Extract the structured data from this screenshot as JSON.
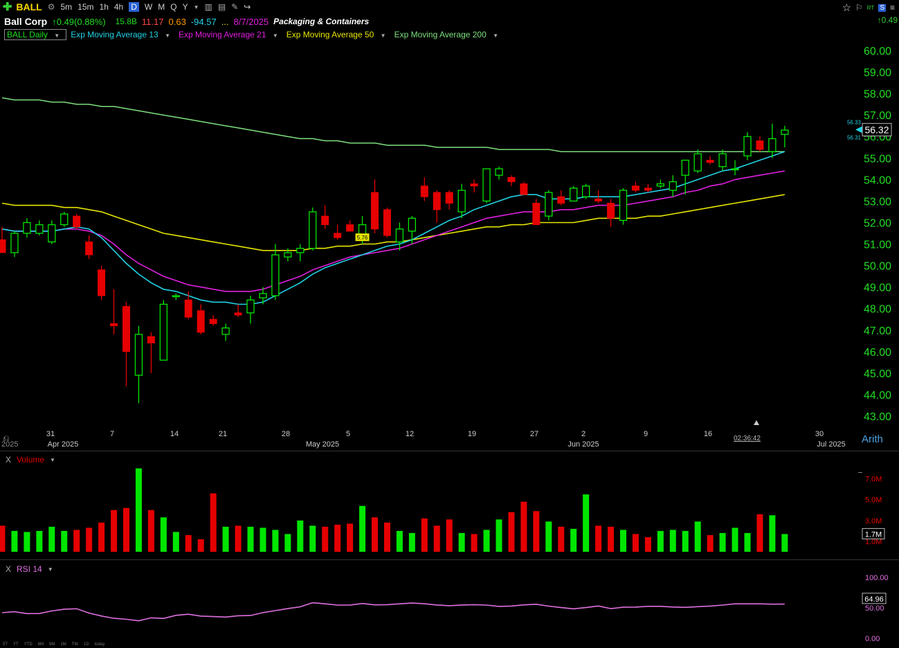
{
  "toolbar": {
    "symbol": "BALL",
    "timeframes": [
      "5m",
      "15m",
      "1h",
      "4h",
      "D",
      "W",
      "M",
      "Q",
      "Y"
    ],
    "active_timeframe": "D"
  },
  "quote": {
    "name": "Ball Corp",
    "change": "0.49(0.88%)",
    "market_cap": "15.8B",
    "stat1": "11.17",
    "stat2": "0.63",
    "stat3": "-94.57",
    "ellipsis": "...",
    "earnings_date": "8/7/2025",
    "industry": "Packaging & Containers"
  },
  "top_right": {
    "rt": "RT",
    "change": "0.49"
  },
  "studies": {
    "main": "BALL Daily",
    "ema13": "Exp Moving Average 13",
    "ema21": "Exp Moving Average 21",
    "ema50": "Exp Moving Average 50",
    "ema200": "Exp Moving Average 200"
  },
  "colors": {
    "up": "#00e600",
    "down": "#e60000",
    "ema13": "#22d3e6",
    "ema21": "#e020e0",
    "ema50": "#e6e600",
    "ema200": "#7de07d",
    "rsi": "#e070e0",
    "axis_text": "#22dd22"
  },
  "price_axis": {
    "labels": [
      "60.00",
      "59.00",
      "58.00",
      "57.00",
      "56.00",
      "55.00",
      "54.00",
      "53.00",
      "52.00",
      "51.00",
      "50.00",
      "49.00",
      "48.00",
      "47.00",
      "46.00",
      "45.00",
      "44.00",
      "43.00"
    ],
    "last_price": "56.32",
    "bid": "56.33",
    "ask": "56.31",
    "min": 43.0,
    "max": 60.0,
    "scale_label": "Arith",
    "timer": "02:36:42",
    "marker_label": "5.76"
  },
  "date_axis": {
    "labels": [
      "31",
      "Apr 2025",
      "7",
      "14",
      "21",
      "28",
      "May 2025",
      "5",
      "12",
      "19",
      "27",
      "Jun 2025",
      "2",
      "9",
      "16",
      "30",
      "Jul 2025"
    ],
    "cut_label": "2025"
  },
  "chart_data": {
    "type": "candlestick",
    "ohlc": [
      [
        51.2,
        51.8,
        50.8,
        50.6
      ],
      [
        50.6,
        51.6,
        50.4,
        51.5
      ],
      [
        51.5,
        52.2,
        51.3,
        52.0
      ],
      [
        51.5,
        52.1,
        51.4,
        51.9
      ],
      [
        51.1,
        52.1,
        51.0,
        51.9
      ],
      [
        51.9,
        52.5,
        51.8,
        52.4
      ],
      [
        52.3,
        52.4,
        51.7,
        51.8
      ],
      [
        51.1,
        51.4,
        50.3,
        50.5
      ],
      [
        49.8,
        50.0,
        48.4,
        48.6
      ],
      [
        47.3,
        48.9,
        46.8,
        47.2
      ],
      [
        48.1,
        48.3,
        44.4,
        46.0
      ],
      [
        44.9,
        47.2,
        43.6,
        46.8
      ],
      [
        46.7,
        46.9,
        45.0,
        46.4
      ],
      [
        45.6,
        48.4,
        45.7,
        48.2
      ],
      [
        48.6,
        48.7,
        48.4,
        48.6
      ],
      [
        48.4,
        48.8,
        47.5,
        47.6
      ],
      [
        47.9,
        48.2,
        46.8,
        46.9
      ],
      [
        47.5,
        47.7,
        47.2,
        47.3
      ],
      [
        46.8,
        47.3,
        46.5,
        47.1
      ],
      [
        47.8,
        48.2,
        47.6,
        47.7
      ],
      [
        47.8,
        48.6,
        47.3,
        48.4
      ],
      [
        48.5,
        49.0,
        48.2,
        48.7
      ],
      [
        48.6,
        51.0,
        48.4,
        50.5
      ],
      [
        50.4,
        50.8,
        50.2,
        50.6
      ],
      [
        50.6,
        51.0,
        50.2,
        50.8
      ],
      [
        50.8,
        52.7,
        50.7,
        52.5
      ],
      [
        52.3,
        52.8,
        51.7,
        51.9
      ],
      [
        51.5,
        51.9,
        51.2,
        51.3
      ],
      [
        51.9,
        52.1,
        51.6,
        51.6
      ],
      [
        51.3,
        52.3,
        51.0,
        51.9
      ],
      [
        53.4,
        54.0,
        51.5,
        51.7
      ],
      [
        52.6,
        52.7,
        51.3,
        51.4
      ],
      [
        51.1,
        52.0,
        50.7,
        51.7
      ],
      [
        51.6,
        52.3,
        51.0,
        52.2
      ],
      [
        53.7,
        54.1,
        53.0,
        53.2
      ],
      [
        53.4,
        53.5,
        52.0,
        52.6
      ],
      [
        53.4,
        53.5,
        52.6,
        52.9
      ],
      [
        52.5,
        53.8,
        52.2,
        53.5
      ],
      [
        53.8,
        54.0,
        53.4,
        53.7
      ],
      [
        53.0,
        54.5,
        52.9,
        54.5
      ],
      [
        54.2,
        54.6,
        54.0,
        54.5
      ],
      [
        54.1,
        54.2,
        53.7,
        53.9
      ],
      [
        53.8,
        53.9,
        53.4,
        53.3
      ],
      [
        52.9,
        53.1,
        51.9,
        51.9
      ],
      [
        52.3,
        53.5,
        52.1,
        53.4
      ],
      [
        53.2,
        53.5,
        52.8,
        52.9
      ],
      [
        53.0,
        53.7,
        53.0,
        53.6
      ],
      [
        53.2,
        53.8,
        53.1,
        53.7
      ],
      [
        53.1,
        53.5,
        52.9,
        53.0
      ],
      [
        52.9,
        53.1,
        51.8,
        52.2
      ],
      [
        52.1,
        53.6,
        51.9,
        53.5
      ],
      [
        53.7,
        53.9,
        53.4,
        53.5
      ],
      [
        53.6,
        53.8,
        53.4,
        53.5
      ],
      [
        53.7,
        54.0,
        53.6,
        53.8
      ],
      [
        53.5,
        54.2,
        53.2,
        53.9
      ],
      [
        54.2,
        54.6,
        53.3,
        54.9
      ],
      [
        54.4,
        55.4,
        54.3,
        55.2
      ],
      [
        54.9,
        55.1,
        54.7,
        54.8
      ],
      [
        54.6,
        55.4,
        54.4,
        55.2
      ],
      [
        54.5,
        54.9,
        54.2,
        54.5
      ],
      [
        55.1,
        56.2,
        54.9,
        56.0
      ],
      [
        55.8,
        56.0,
        55.3,
        55.4
      ],
      [
        55.3,
        56.6,
        55.0,
        55.9
      ],
      [
        56.1,
        56.5,
        55.5,
        56.3
      ]
    ],
    "ema13": [
      51.7,
      51.6,
      51.6,
      51.6,
      51.6,
      51.7,
      51.8,
      51.7,
      51.3,
      50.7,
      50.1,
      49.6,
      49.2,
      48.9,
      48.8,
      48.6,
      48.4,
      48.3,
      48.3,
      48.2,
      48.2,
      48.3,
      48.6,
      48.9,
      49.2,
      49.6,
      49.9,
      50.1,
      50.3,
      50.5,
      50.7,
      50.9,
      51.0,
      51.2,
      51.5,
      51.8,
      52.1,
      52.3,
      52.6,
      52.8,
      53.0,
      53.2,
      53.3,
      53.3,
      53.1,
      53.1,
      53.1,
      53.2,
      53.2,
      53.2,
      53.2,
      53.3,
      53.4,
      53.5,
      53.6,
      53.8,
      54.0,
      54.2,
      54.4,
      54.5,
      54.7,
      54.9,
      55.1,
      55.3
    ],
    "ema21": [
      51.7,
      51.6,
      51.6,
      51.6,
      51.6,
      51.7,
      51.7,
      51.6,
      51.4,
      51.0,
      50.5,
      50.1,
      49.8,
      49.5,
      49.3,
      49.1,
      49.0,
      48.9,
      48.8,
      48.8,
      48.8,
      48.9,
      49.1,
      49.3,
      49.5,
      49.8,
      50.0,
      50.2,
      50.4,
      50.5,
      50.6,
      50.7,
      50.8,
      51.0,
      51.2,
      51.4,
      51.6,
      51.8,
      52.0,
      52.2,
      52.3,
      52.4,
      52.5,
      52.5,
      52.5,
      52.6,
      52.6,
      52.7,
      52.8,
      52.8,
      52.8,
      52.9,
      53.0,
      53.1,
      53.2,
      53.4,
      53.5,
      53.7,
      53.8,
      54.0,
      54.1,
      54.2,
      54.3,
      54.4
    ],
    "ema50": [
      52.9,
      52.8,
      52.8,
      52.8,
      52.8,
      52.7,
      52.7,
      52.6,
      52.5,
      52.3,
      52.1,
      51.9,
      51.7,
      51.5,
      51.4,
      51.3,
      51.2,
      51.1,
      51.0,
      50.9,
      50.8,
      50.7,
      50.7,
      50.7,
      50.7,
      50.8,
      50.8,
      50.9,
      50.9,
      51.0,
      51.0,
      51.1,
      51.1,
      51.2,
      51.3,
      51.4,
      51.5,
      51.6,
      51.7,
      51.8,
      51.8,
      51.9,
      51.9,
      52.0,
      52.0,
      52.0,
      52.0,
      52.1,
      52.2,
      52.2,
      52.2,
      52.2,
      52.3,
      52.3,
      52.4,
      52.5,
      52.6,
      52.7,
      52.8,
      52.9,
      53.0,
      53.1,
      53.2,
      53.3
    ],
    "ema200": [
      57.8,
      57.7,
      57.7,
      57.7,
      57.6,
      57.6,
      57.5,
      57.5,
      57.4,
      57.4,
      57.3,
      57.2,
      57.1,
      57.0,
      56.9,
      56.8,
      56.7,
      56.6,
      56.5,
      56.4,
      56.3,
      56.2,
      56.1,
      56.0,
      55.9,
      55.9,
      55.8,
      55.8,
      55.7,
      55.7,
      55.7,
      55.6,
      55.6,
      55.6,
      55.6,
      55.5,
      55.5,
      55.5,
      55.5,
      55.5,
      55.4,
      55.4,
      55.4,
      55.4,
      55.4,
      55.3,
      55.3,
      55.3,
      55.3,
      55.3,
      55.3,
      55.3,
      55.3,
      55.3,
      55.3,
      55.3,
      55.3,
      55.3,
      55.3,
      55.3,
      55.3,
      55.3,
      55.3,
      55.3
    ],
    "volume": [
      2.5,
      2.0,
      1.9,
      2.0,
      2.4,
      2.0,
      2.1,
      2.3,
      2.8,
      4.0,
      4.2,
      8.0,
      4.0,
      3.3,
      1.9,
      1.6,
      1.2,
      5.6,
      2.4,
      2.5,
      2.4,
      2.3,
      2.1,
      1.7,
      3.0,
      2.5,
      2.4,
      2.6,
      2.7,
      4.4,
      3.3,
      2.8,
      2.0,
      1.8,
      3.2,
      2.5,
      3.1,
      1.8,
      1.7,
      2.1,
      3.1,
      3.8,
      4.8,
      3.9,
      2.9,
      2.4,
      2.2,
      5.5,
      2.5,
      2.4,
      2.1,
      1.7,
      1.4,
      2.0,
      2.1,
      2.0,
      2.9,
      1.6,
      1.8,
      2.3,
      1.8,
      3.6,
      3.5,
      1.7
    ],
    "volume_axis": [
      "7.0M",
      "5.0M",
      "3.0M",
      "1.0M"
    ],
    "volume_last": "1.7M",
    "rsi": [
      42.0,
      43.6,
      40.6,
      40.7,
      44.9,
      47.8,
      48.5,
      41.5,
      36.6,
      32.8,
      31.2,
      28.7,
      33.6,
      32.6,
      37.7,
      39.5,
      36.5,
      35.7,
      34.9,
      37.0,
      37.4,
      42.2,
      45.4,
      48.7,
      51.7,
      58.4,
      56.6,
      54.5,
      54.6,
      57.2,
      54.9,
      55.2,
      56.6,
      57.8,
      56.7,
      54.7,
      53.5,
      54.7,
      55.2,
      54.5,
      52.4,
      53.0,
      54.9,
      55.9,
      52.8,
      50.4,
      48.4,
      50.4,
      53.1,
      48.8,
      51.0,
      51.2,
      52.5,
      52.5,
      51.4,
      50.8,
      51.9,
      52.9,
      54.6,
      56.6,
      56.6,
      56.6,
      56.0,
      56.1
    ],
    "rsi_axis": [
      "100.00",
      "50.00",
      "0.00"
    ],
    "rsi_last": "64.96"
  },
  "panes": {
    "volume": {
      "close": "X",
      "label": "Volume"
    },
    "rsi": {
      "close": "X",
      "label": "RSI 14"
    }
  },
  "range_buttons": [
    "5T",
    "YT",
    "YTD",
    "6M",
    "9M",
    "1M",
    "TW",
    "1D",
    "today"
  ]
}
